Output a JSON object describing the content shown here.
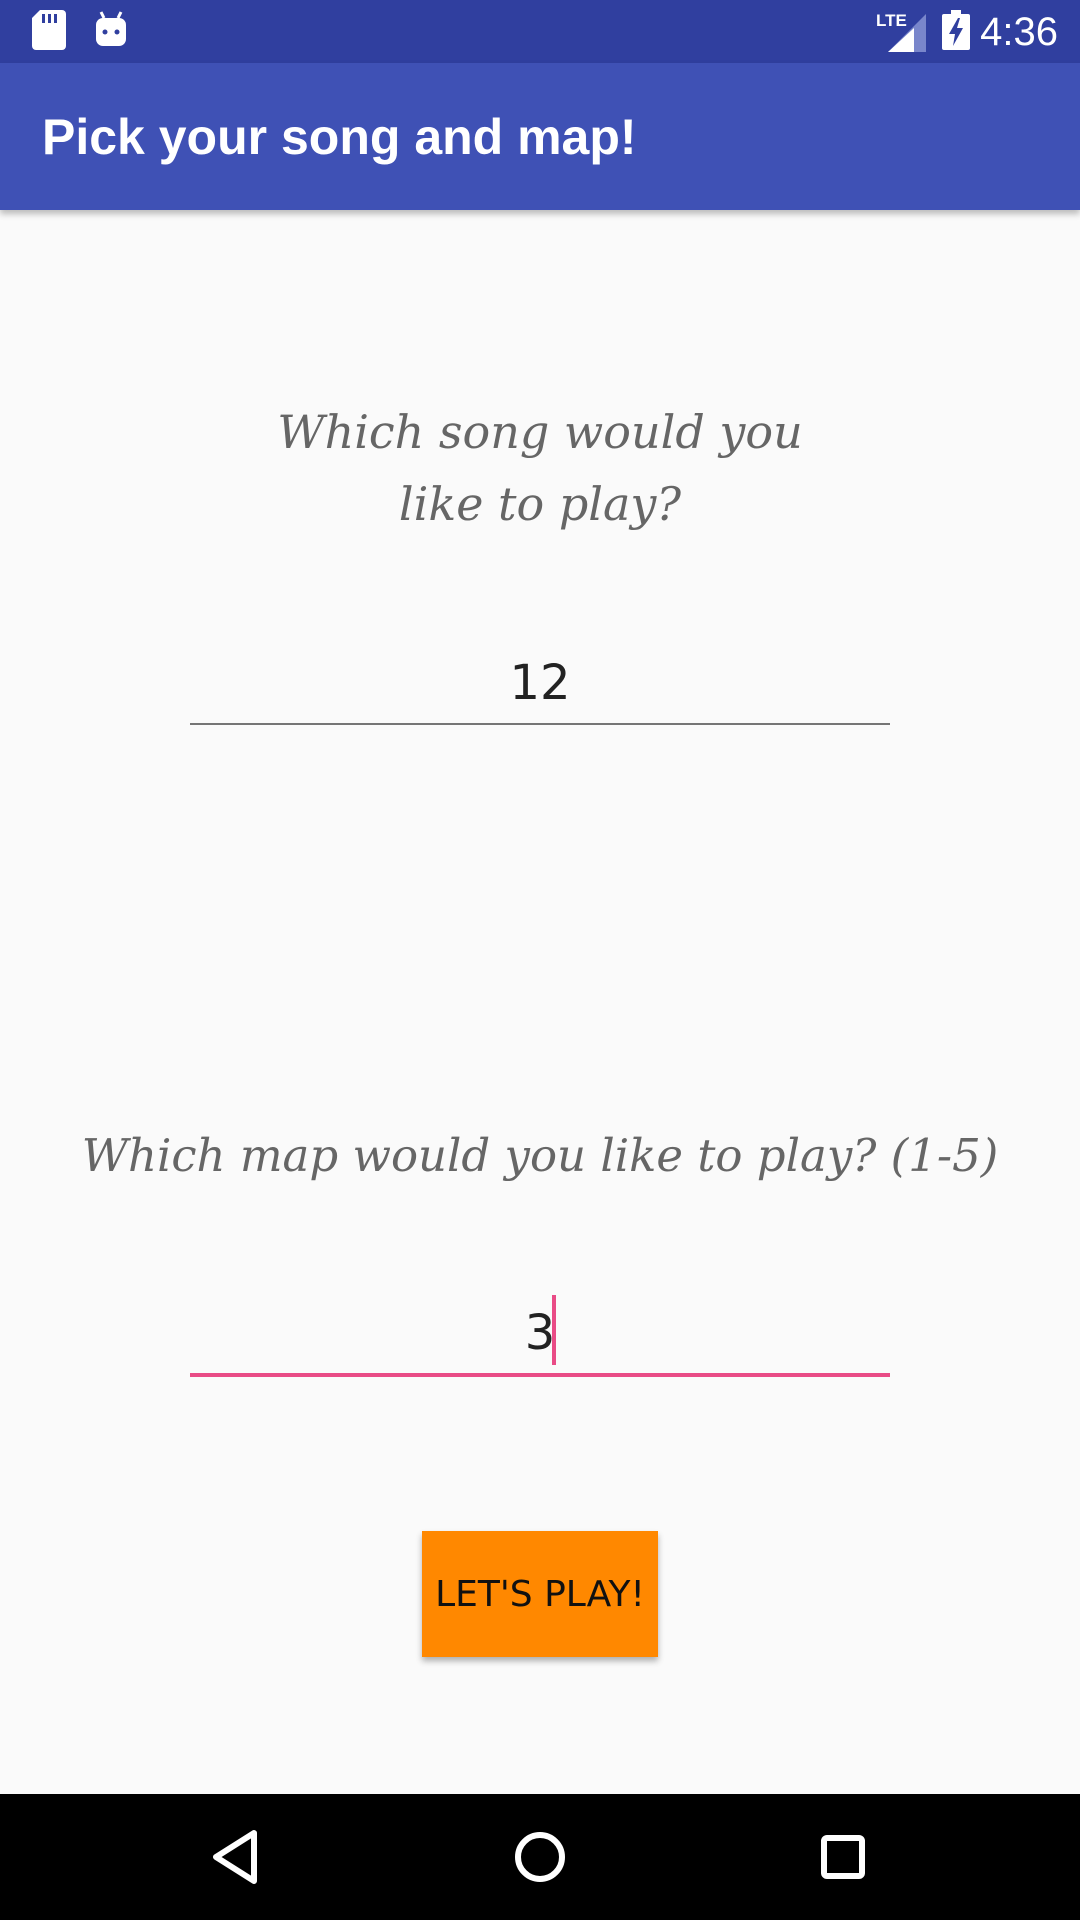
{
  "status_bar": {
    "time": "4:36",
    "network": "LTE",
    "icons": [
      "sd-card-icon",
      "android-icon",
      "lte-signal-icon",
      "battery-charging-icon"
    ]
  },
  "app_bar": {
    "title": "Pick your song and map!"
  },
  "song_section": {
    "question": "Which song would you like to play?",
    "value": "12"
  },
  "map_section": {
    "question": "Which map would you like to play? (1-5)",
    "value": "3"
  },
  "play_button": {
    "label": "LET'S PLAY!"
  },
  "nav_bar": {
    "icons": [
      "back-icon",
      "home-icon",
      "recents-icon"
    ]
  },
  "colors": {
    "status_bar": "#303f9f",
    "app_bar": "#3f51b5",
    "accent": "#e94b86",
    "button": "#ff8800",
    "background": "#fafafa"
  }
}
